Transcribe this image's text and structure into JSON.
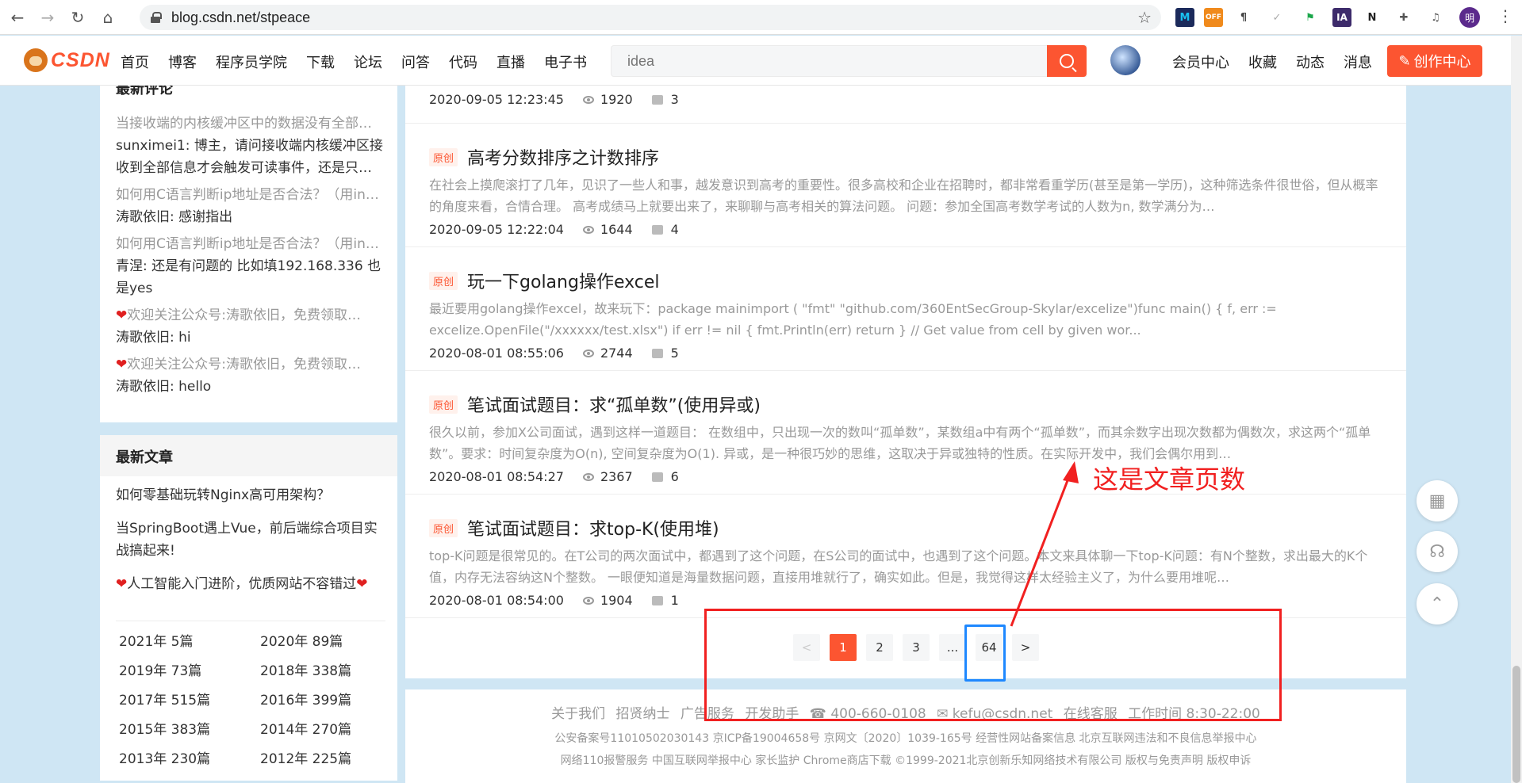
{
  "browser": {
    "url": "blog.csdn.net/stpeace",
    "avatar_initial": "明"
  },
  "header": {
    "logo": "CSDN",
    "nav": [
      "首页",
      "博客",
      "程序员学院",
      "下载",
      "论坛",
      "问答",
      "代码",
      "直播",
      "电子书"
    ],
    "search_placeholder": "idea",
    "right_nav": [
      "会员中心",
      "收藏",
      "动态",
      "消息"
    ],
    "create_label": "创作中心"
  },
  "sidebar": {
    "comments_title": "最新评论",
    "comments": [
      {
        "article": "当接收端的内核缓冲区中的数据没有全部…",
        "text": "sunximei1: 博主，请问接收端内核缓冲区接收到全部信息才会触发可读事件，还是只…"
      },
      {
        "article": "如何用C语言判断ip地址是否合法？（用in…",
        "text": "涛歌依旧: 感谢指出"
      },
      {
        "article": "如何用C语言判断ip地址是否合法？（用in…",
        "text": "青涅: 还是有问题的 比如填192.168.336 也是yes"
      },
      {
        "article": "欢迎关注公众号:涛歌依旧，免费领取…",
        "text": "涛歌依旧: hi"
      },
      {
        "article": "欢迎关注公众号:涛歌依旧，免费领取…",
        "text": "涛歌依旧: hello"
      }
    ],
    "newest_title": "最新文章",
    "newest": [
      "如何零基础玩转Nginx高可用架构？",
      "当SpringBoot遇上Vue，前后端综合项目实战搞起来!",
      "人工智能入门进阶，优质网站不容错过"
    ],
    "archive": [
      "2021年 5篇",
      "2020年 89篇",
      "2019年 73篇",
      "2018年 338篇",
      "2017年 515篇",
      "2016年 399篇",
      "2015年 383篇",
      "2014年 270篇",
      "2013年 230篇",
      "2012年 225篇"
    ]
  },
  "articles": {
    "top_partial": {
      "date": "2020-09-05 12:23:45",
      "views": "1920",
      "comments": "3"
    },
    "badge": "原创",
    "items": [
      {
        "title": "高考分数排序之计数排序",
        "desc": "在社会上摸爬滚打了几年，见识了一些人和事，越发意识到高考的重要性。很多高校和企业在招聘时，都非常看重学历(甚至是第一学历)，这种筛选条件很世俗，但从概率的角度来看，合情合理。 高考成绩马上就要出来了，来聊聊与高考相关的算法问题。 问题：参加全国高考数学考试的人数为n, 数学满分为…",
        "date": "2020-09-05 12:22:04",
        "views": "1644",
        "comments": "4"
      },
      {
        "title": "玩一下golang操作excel",
        "desc": "最近要用golang操作excel，故来玩下：package mainimport ( \"fmt\" \"github.com/360EntSecGroup-Skylar/excelize\")func main() { f, err := excelize.OpenFile(\"/xxxxxx/test.xlsx\") if err != nil { fmt.Println(err) return } // Get value from cell by given wor...",
        "date": "2020-08-01 08:55:06",
        "views": "2744",
        "comments": "5"
      },
      {
        "title": "笔试面试题目：求“孤单数”(使用异或)",
        "desc": "很久以前，参加X公司面试，遇到这样一道题目： 在数组中，只出现一次的数叫“孤单数”，某数组a中有两个“孤单数”，而其余数字出现次数都为偶数次，求这两个“孤单数”。要求：时间复杂度为O(n), 空间复杂度为O(1). 异或，是一种很巧妙的思维，这取决于异或独特的性质。在实际开发中，我们会偶尔用到…",
        "date": "2020-08-01 08:54:27",
        "views": "2367",
        "comments": "6"
      },
      {
        "title": "笔试面试题目：求top-K(使用堆)",
        "desc": "top-K问题是很常见的。在T公司的两次面试中，都遇到了这个问题，在S公司的面试中，也遇到了这个问题。本文来具体聊一下top-K问题：有N个整数，求出最大的K个值，内存无法容纳这N个整数。 一眼便知道是海量数据问题，直接用堆就行了，确实如此。但是，我觉得这样太经验主义了，为什么要用堆呢…",
        "date": "2020-08-01 08:54:00",
        "views": "1904",
        "comments": "1"
      }
    ]
  },
  "pagination": {
    "prev": "<",
    "pages": [
      "1",
      "2",
      "3",
      "...",
      "64"
    ],
    "next": ">",
    "current": "1"
  },
  "footer": {
    "line1": [
      "关于我们",
      "招贤纳士",
      "广告服务",
      "开发助手",
      "☎ 400-660-0108",
      "✉ kefu@csdn.net",
      "在线客服",
      "工作时间 8:30-22:00"
    ],
    "line2": "公安备案号11010502030143 京ICP备19004658号 京网文〔2020〕1039-165号 经营性网站备案信息 北京互联网违法和不良信息举报中心",
    "line3": "网络110报警服务 中国互联网举报中心 家长监护 Chrome商店下载 ©1999-2021北京创新乐知网络技术有限公司 版权与免责声明 版权申诉"
  },
  "annotation": {
    "text": "这是文章页数",
    "color": "#f12020",
    "highlight_color": "#1e88ff"
  }
}
